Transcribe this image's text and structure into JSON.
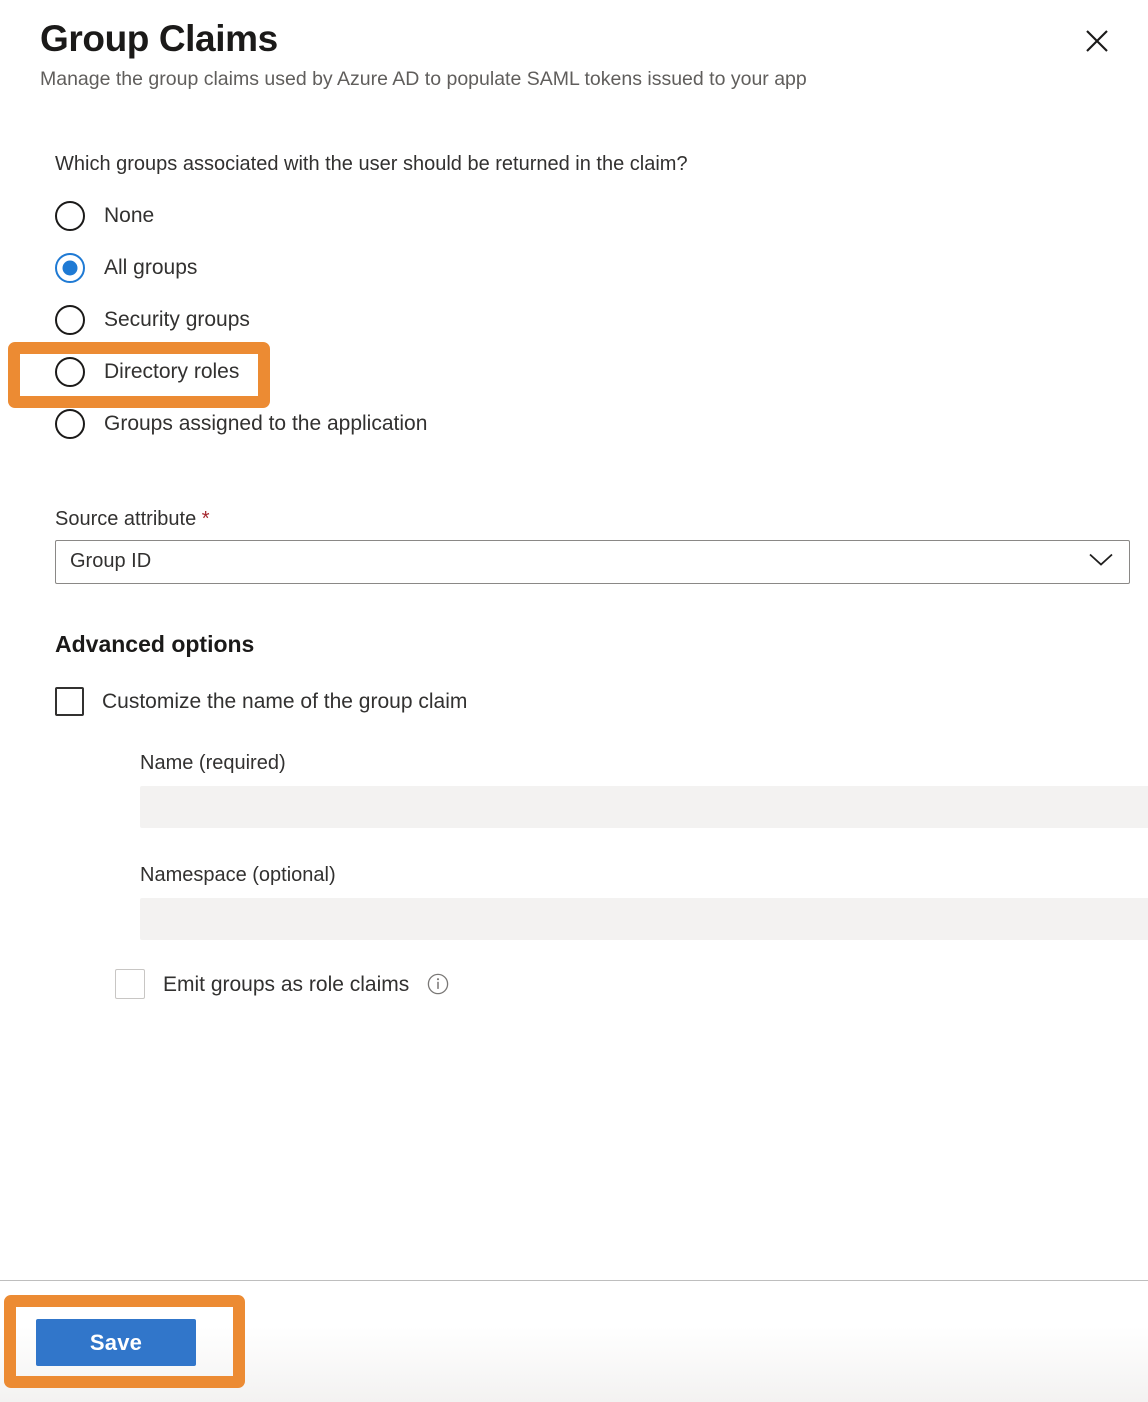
{
  "header": {
    "title": "Group Claims",
    "subtitle": "Manage the group claims used by Azure AD to populate SAML tokens issued to your app",
    "close_icon": "close-icon"
  },
  "main": {
    "question": "Which groups associated with the user should be returned in the claim?",
    "radio_options": [
      {
        "label": "None",
        "selected": false
      },
      {
        "label": "All groups",
        "selected": true
      },
      {
        "label": "Security groups",
        "selected": false
      },
      {
        "label": "Directory roles",
        "selected": false
      },
      {
        "label": "Groups assigned to the application",
        "selected": false
      }
    ],
    "source_attribute": {
      "label": "Source attribute",
      "required_marker": "*",
      "value": "Group ID",
      "chevron_icon": "chevron-down-icon"
    },
    "advanced": {
      "section_title": "Advanced options",
      "customize_checkbox": {
        "label": "Customize the name of the group claim",
        "checked": false
      },
      "name_field": {
        "label": "Name (required)",
        "value": "",
        "disabled": true
      },
      "namespace_field": {
        "label": "Namespace (optional)",
        "value": "",
        "disabled": true
      },
      "emit_checkbox": {
        "label": "Emit groups as role claims",
        "checked": false,
        "info_icon": "info-icon"
      }
    }
  },
  "footer": {
    "save_label": "Save"
  },
  "highlights": {
    "color": "#ec8b33",
    "targets": [
      "All groups radio option",
      "Save button"
    ]
  },
  "colors": {
    "accent_blue": "#1f7ad4",
    "save_button_blue": "#3176ca",
    "highlight_orange": "#ec8b33",
    "required_red": "#a4262c",
    "disabled_input_gray": "#f3f2f1"
  }
}
